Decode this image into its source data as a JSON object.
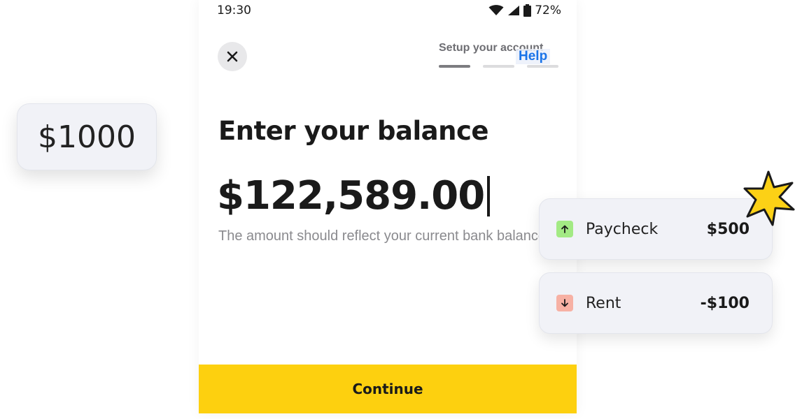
{
  "floating_chip": {
    "amount": "$1000"
  },
  "status_bar": {
    "time": "19:30",
    "battery": "72%"
  },
  "header": {
    "setup_label": "Setup your account",
    "help_label": "Help",
    "progress_steps": 3,
    "active_step": 1
  },
  "main": {
    "heading": "Enter your balance",
    "amount_value": "$122,589.00",
    "helper_text": "The amount  should reflect your current bank balance"
  },
  "footer": {
    "continue_label": "Continue"
  },
  "transactions": [
    {
      "label": "Paycheck",
      "amount": "$500",
      "direction": "up",
      "icon": "arrow-up-icon",
      "color": "#a3ea84"
    },
    {
      "label": "Rent",
      "amount": "-$100",
      "direction": "down",
      "icon": "arrow-down-icon",
      "color": "#f7b1a4"
    }
  ],
  "colors": {
    "accent": "#fdd00f",
    "link": "#1a73e8",
    "star": "#fcd116"
  }
}
